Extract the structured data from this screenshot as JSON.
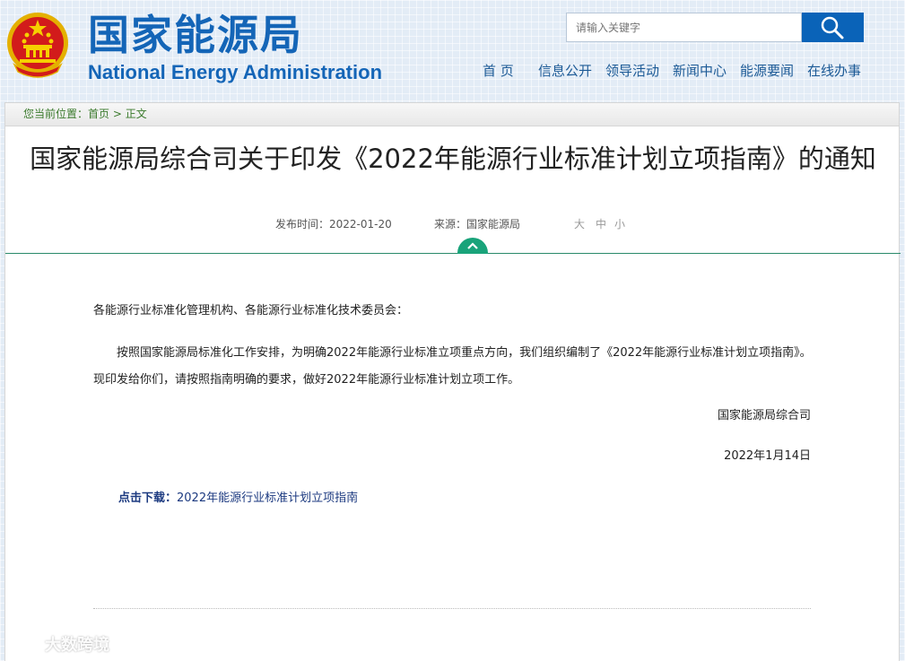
{
  "header": {
    "logo_cn": "国家能源局",
    "logo_en": "National Energy Administration",
    "search_placeholder": "请输入关键字"
  },
  "nav": {
    "items": [
      "首 页",
      "信息公开",
      "领导活动",
      "新闻中心",
      "能源要闻",
      "在线办事"
    ]
  },
  "breadcrumb": {
    "prefix": "您当前位置：",
    "home": "首页",
    "separator": " > ",
    "current": "正文"
  },
  "article": {
    "title": "国家能源局综合司关于印发《2022年能源行业标准计划立项指南》的通知",
    "publish_label": "发布时间：",
    "publish_date": "2022-01-20",
    "source_label": "来源：",
    "source": "国家能源局",
    "font_sizes": [
      "大",
      "中",
      "小"
    ],
    "salutation": "各能源行业标准化管理机构、各能源行业标准化技术委员会：",
    "paragraph": "按照国家能源局标准化工作安排，为明确2022年能源行业标准立项重点方向，我们组织编制了《2022年能源行业标准计划立项指南》。现印发给你们，请按照指南明确的要求，做好2022年能源行业标准计划立项工作。",
    "signature": "国家能源局综合司",
    "sign_date": "2022年1月14日",
    "download_label": "点击下载：",
    "download_link": "2022年能源行业标准计划立项指南"
  },
  "watermark": {
    "text": "大数跨境"
  },
  "colors": {
    "brand_blue": "#1465b7",
    "search_button": "#0a63b8",
    "accent_green": "#19a37a",
    "breadcrumb_text": "#3a7a2c"
  }
}
